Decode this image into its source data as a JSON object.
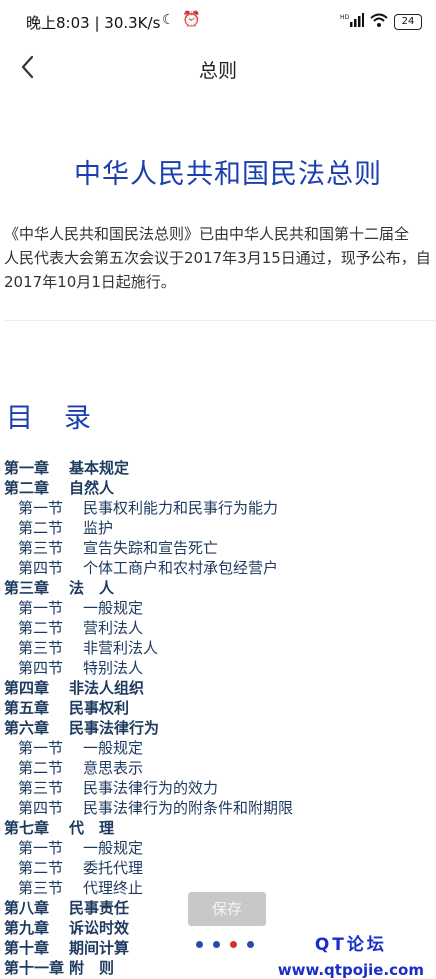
{
  "status_bar": {
    "text": "晚上8:03 | 30.3K/s",
    "battery": "24",
    "icons": [
      "moon-icon",
      "alarm-icon",
      "hd-signal-icon",
      "wifi-icon",
      "battery-icon"
    ]
  },
  "nav": {
    "title": "总则",
    "back_icon": "chevron-left-icon"
  },
  "document": {
    "title": "中华人民共和国民法总则",
    "intro": [
      "《中华人民共和国民法总则》已由中华人民共和国第十二届全",
      "人民代表大会第五次会议于2017年3月15日通过，现予公布，自",
      "2017年10月1日起施行。"
    ]
  },
  "toc": {
    "heading": "目　录",
    "items": [
      {
        "level": "chapter",
        "num": "第一章",
        "title": "基本规定"
      },
      {
        "level": "chapter",
        "num": "第二章",
        "title": "自然人"
      },
      {
        "level": "section",
        "num": "第一节",
        "title": "民事权利能力和民事行为能力"
      },
      {
        "level": "section",
        "num": "第二节",
        "title": "监护"
      },
      {
        "level": "section",
        "num": "第三节",
        "title": "宣告失踪和宣告死亡"
      },
      {
        "level": "section",
        "num": "第四节",
        "title": "个体工商户和农村承包经营户"
      },
      {
        "level": "chapter",
        "num": "第三章",
        "title": "法　人"
      },
      {
        "level": "section",
        "num": "第一节",
        "title": "一般规定"
      },
      {
        "level": "section",
        "num": "第二节",
        "title": "营利法人"
      },
      {
        "level": "section",
        "num": "第三节",
        "title": "非营利法人"
      },
      {
        "level": "section",
        "num": "第四节",
        "title": "特别法人"
      },
      {
        "level": "chapter",
        "num": "第四章",
        "title": "非法人组织"
      },
      {
        "level": "chapter",
        "num": "第五章",
        "title": "民事权利"
      },
      {
        "level": "chapter",
        "num": "第六章",
        "title": "民事法律行为"
      },
      {
        "level": "section",
        "num": "第一节",
        "title": "一般规定"
      },
      {
        "level": "section",
        "num": "第二节",
        "title": "意思表示"
      },
      {
        "level": "section",
        "num": "第三节",
        "title": "民事法律行为的效力"
      },
      {
        "level": "section",
        "num": "第四节",
        "title": "民事法律行为的附条件和附期限"
      },
      {
        "level": "chapter",
        "num": "第七章",
        "title": "代　理"
      },
      {
        "level": "section",
        "num": "第一节",
        "title": "一般规定"
      },
      {
        "level": "section",
        "num": "第二节",
        "title": "委托代理"
      },
      {
        "level": "section",
        "num": "第三节",
        "title": "代理终止"
      },
      {
        "level": "chapter",
        "num": "第八章",
        "title": "民事责任"
      },
      {
        "level": "chapter",
        "num": "第九章",
        "title": "诉讼时效"
      },
      {
        "level": "chapter",
        "num": "第十章",
        "title": "期间计算"
      },
      {
        "level": "chapter",
        "num": "第十一章",
        "title": "附　则"
      }
    ]
  },
  "save_button": {
    "label": "保存"
  },
  "pager": {
    "count": 4,
    "active_index": 2
  },
  "watermark": {
    "line1": "QT论坛",
    "line2": "www.qtpojie.com"
  }
}
